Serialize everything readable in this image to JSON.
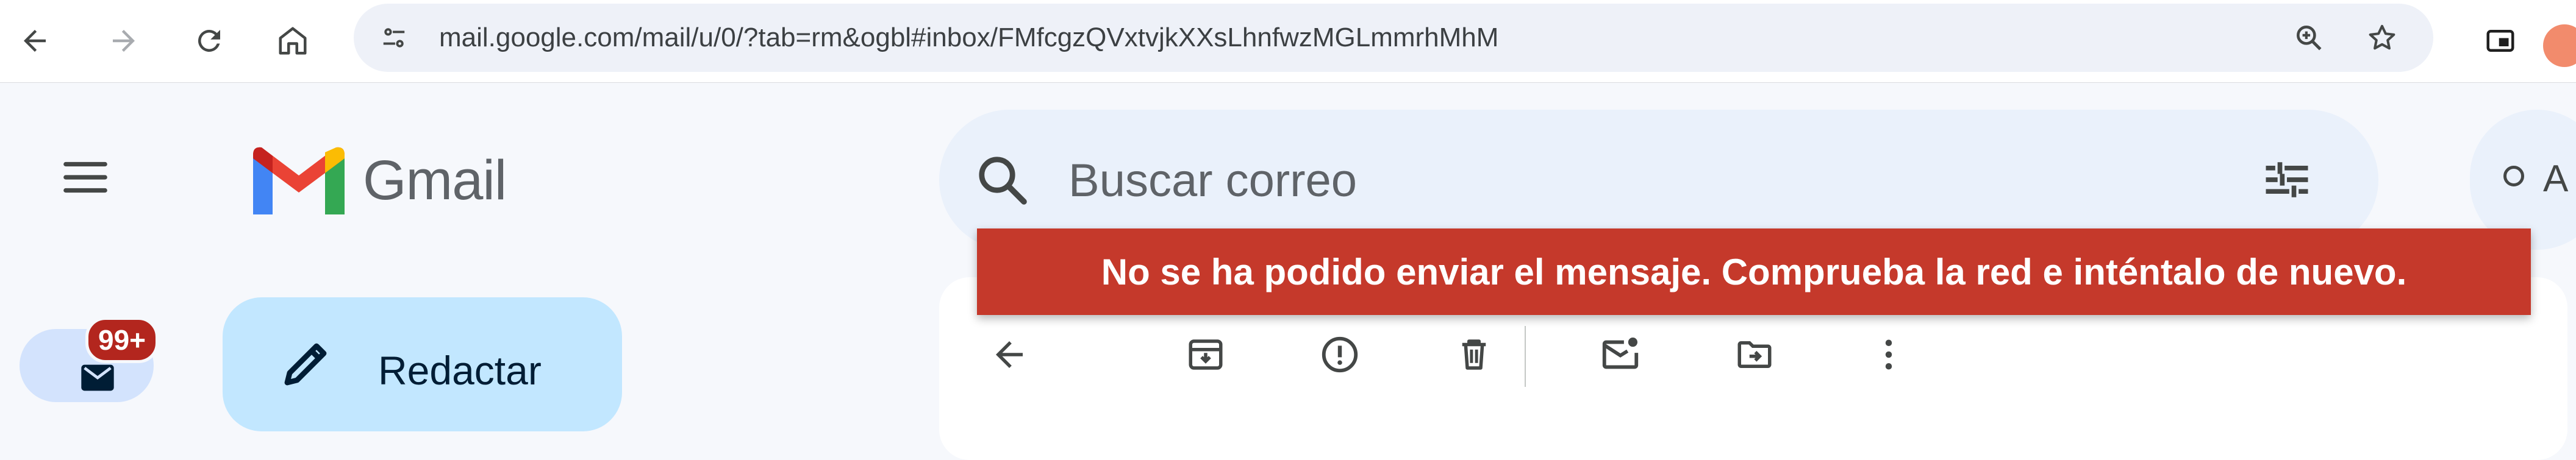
{
  "browser": {
    "url": "mail.google.com/mail/u/0/?tab=rm&ogbl#inbox/FMfcgzQVxtvjkXXsLhnfwzMGLmmrhMhM",
    "icons": [
      "back-icon",
      "forward-icon",
      "reload-icon",
      "home-icon",
      "site-info-icon",
      "zoom-icon",
      "star-icon",
      "picture-in-picture-icon"
    ]
  },
  "header": {
    "app_name": "Gmail",
    "search_placeholder": "Buscar correo",
    "status_letter": "A"
  },
  "sidebar": {
    "mail_badge": "99+",
    "compose_label": "Redactar"
  },
  "toolbar": {
    "icons": [
      "back-arrow-icon",
      "archive-icon",
      "report-spam-icon",
      "delete-icon",
      "mark-unread-icon",
      "move-to-icon",
      "more-options-icon"
    ]
  },
  "toast": {
    "message": "No se ha podido enviar el mensaje. Comprueba la red e inténtalo de nuevo."
  },
  "colors": {
    "toast_bg": "#c5392b",
    "compose_bg": "#c2e7ff",
    "search_bg": "#eaf1fb",
    "badge_bg": "#b3261e",
    "page_bg": "#f6f8fc"
  }
}
